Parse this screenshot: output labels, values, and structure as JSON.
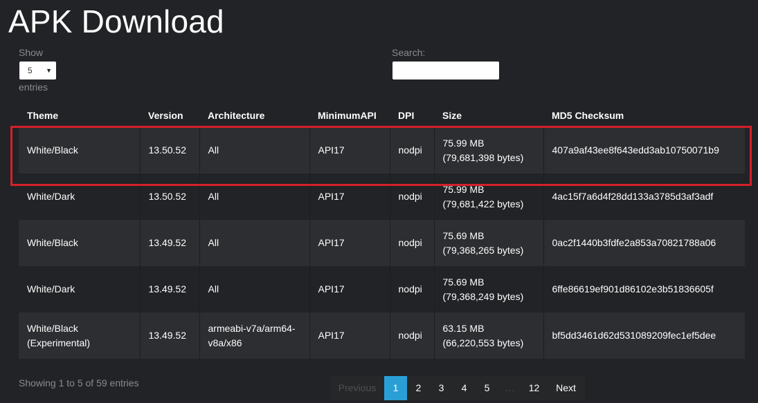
{
  "page_title": "APK Download",
  "length": {
    "show_label": "Show",
    "selected": "5",
    "entries_label": "entries"
  },
  "search": {
    "label": "Search:",
    "value": "",
    "placeholder": ""
  },
  "columns": [
    "Theme",
    "Version",
    "Architecture",
    "MinimumAPI",
    "DPI",
    "Size",
    "MD5 Checksum"
  ],
  "rows": [
    {
      "theme": "White/Black",
      "version": "13.50.52",
      "arch": "All",
      "api": "API17",
      "dpi": "nodpi",
      "size_mb": "75.99 MB",
      "size_bytes": "(79,681,398 bytes)",
      "md5": "407a9af43ee8f643edd3ab10750071b9"
    },
    {
      "theme": "White/Dark",
      "version": "13.50.52",
      "arch": "All",
      "api": "API17",
      "dpi": "nodpi",
      "size_mb": "75.99 MB",
      "size_bytes": "(79,681,422 bytes)",
      "md5": "4ac15f7a6d4f28dd133a3785d3af3adf"
    },
    {
      "theme": "White/Black",
      "version": "13.49.52",
      "arch": "All",
      "api": "API17",
      "dpi": "nodpi",
      "size_mb": "75.69 MB",
      "size_bytes": "(79,368,265 bytes)",
      "md5": "0ac2f1440b3fdfe2a853a70821788a06"
    },
    {
      "theme": "White/Dark",
      "version": "13.49.52",
      "arch": "All",
      "api": "API17",
      "dpi": "nodpi",
      "size_mb": "75.69 MB",
      "size_bytes": "(79,368,249 bytes)",
      "md5": "6ffe86619ef901d86102e3b51836605f"
    },
    {
      "theme": "White/Black (Experimental)",
      "version": "13.49.52",
      "arch": "armeabi-v7a/arm64-v8a/x86",
      "api": "API17",
      "dpi": "nodpi",
      "size_mb": "63.15 MB",
      "size_bytes": "(66,220,553 bytes)",
      "md5": "bf5dd3461d62d531089209fec1ef5dee"
    }
  ],
  "info_text": "Showing 1 to 5 of 59 entries",
  "pagination": {
    "previous": "Previous",
    "pages": [
      "1",
      "2",
      "3",
      "4",
      "5"
    ],
    "ellipsis": "…",
    "last": "12",
    "next": "Next",
    "active_page": "1"
  },
  "colors": {
    "background": "#222326",
    "row_alt": "#2d2e31",
    "accent": "#2a9fd6",
    "highlight": "#d4202b",
    "muted": "#8a8b8f"
  }
}
